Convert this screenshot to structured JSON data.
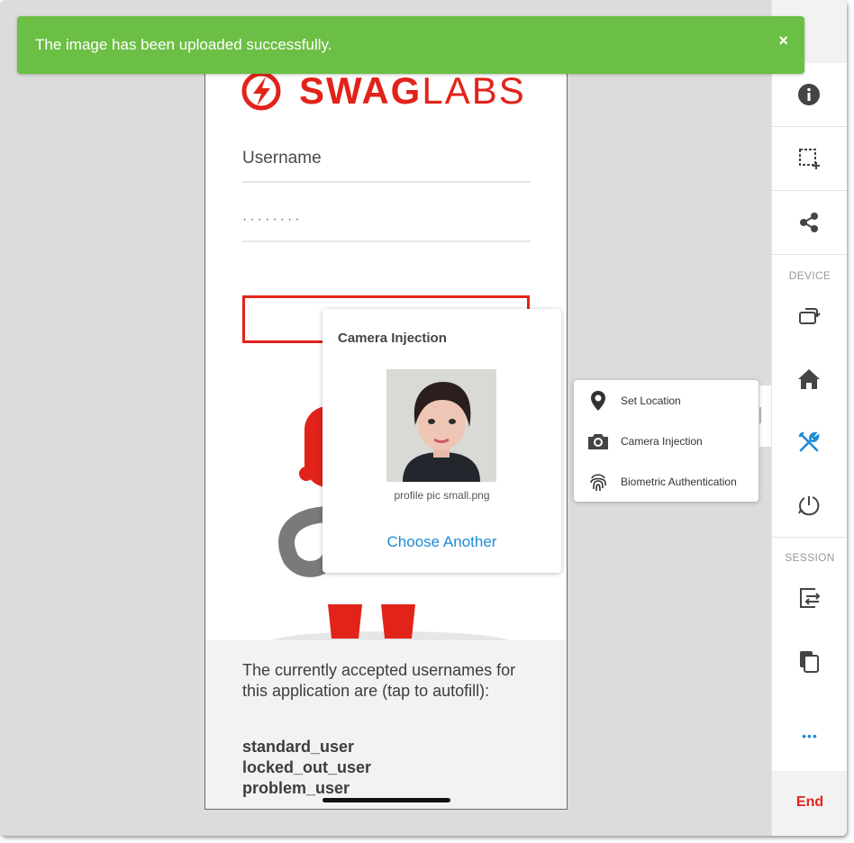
{
  "toast": {
    "message": "The image has been uploaded successfully.",
    "close_glyph": "×",
    "color": "#6cbf45"
  },
  "app": {
    "logo_swag": "SWAG",
    "logo_labs": "LABS",
    "brand_color": "#e2231a",
    "username_placeholder": "Username",
    "password_mask": "········",
    "credentials_intro": "The currently accepted usernames for this application are (tap to autofill):",
    "usernames": [
      "standard_user",
      "locked_out_user",
      "problem_user"
    ]
  },
  "camera_popover": {
    "title": "Camera Injection",
    "filename": "profile pic small.png",
    "choose_label": "Choose Another"
  },
  "tools_menu": {
    "items": [
      {
        "label": "Set Location",
        "icon": "map-pin-icon"
      },
      {
        "label": "Camera Injection",
        "icon": "camera-icon"
      },
      {
        "label": "Biometric Authentication",
        "icon": "fingerprint-icon"
      }
    ]
  },
  "sidebar": {
    "device_section": "DEVICE",
    "session_section": "SESSION",
    "end_label": "End",
    "active_color": "#1e8ad6",
    "more_glyph": "•••"
  }
}
